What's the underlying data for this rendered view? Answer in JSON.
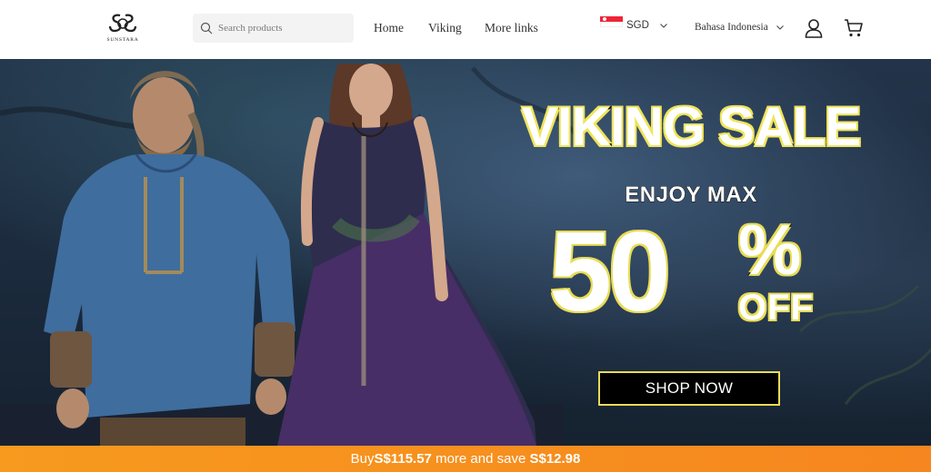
{
  "brand": {
    "logo_text": "SUNSTARA",
    "logo_icon": "sunstara-monogram-icon"
  },
  "search": {
    "placeholder": "Search products",
    "icon": "search-icon"
  },
  "nav": [
    {
      "label": "Home"
    },
    {
      "label": "Viking"
    },
    {
      "label": "More links"
    }
  ],
  "currency": {
    "code": "SGD",
    "flag": "singapore-flag-icon"
  },
  "language": {
    "label": "Bahasa Indonesia"
  },
  "icons": {
    "account": "user-icon",
    "cart": "cart-icon",
    "dropdown": "chevron-down-icon"
  },
  "hero": {
    "title": "VIKING SALE",
    "subtitle": "ENJOY MAX",
    "discount_number": "50",
    "discount_sign": "%",
    "discount_suffix": "OFF",
    "cta_label": "SHOP NOW",
    "colors": {
      "accent_outline": "#e8dc55",
      "cta_bg": "#000000"
    }
  },
  "promo_bar": {
    "prefix": "Buy ",
    "amount_needed": "S$115.57",
    "middle": " more and save ",
    "savings": "S$12.98",
    "color": "#f79a1e"
  }
}
